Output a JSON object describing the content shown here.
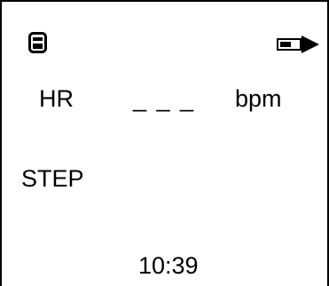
{
  "status_bar": {
    "left_icon": "device-icon",
    "right_icon": "battery-icon",
    "battery_level_fraction": 0.6
  },
  "heart_rate": {
    "label": "HR",
    "value": "_ _ _",
    "unit": "bpm"
  },
  "step": {
    "label": "STEP"
  },
  "clock": {
    "time": "10:39"
  },
  "colors": {
    "foreground": "#000000",
    "background": "#ffffff"
  }
}
